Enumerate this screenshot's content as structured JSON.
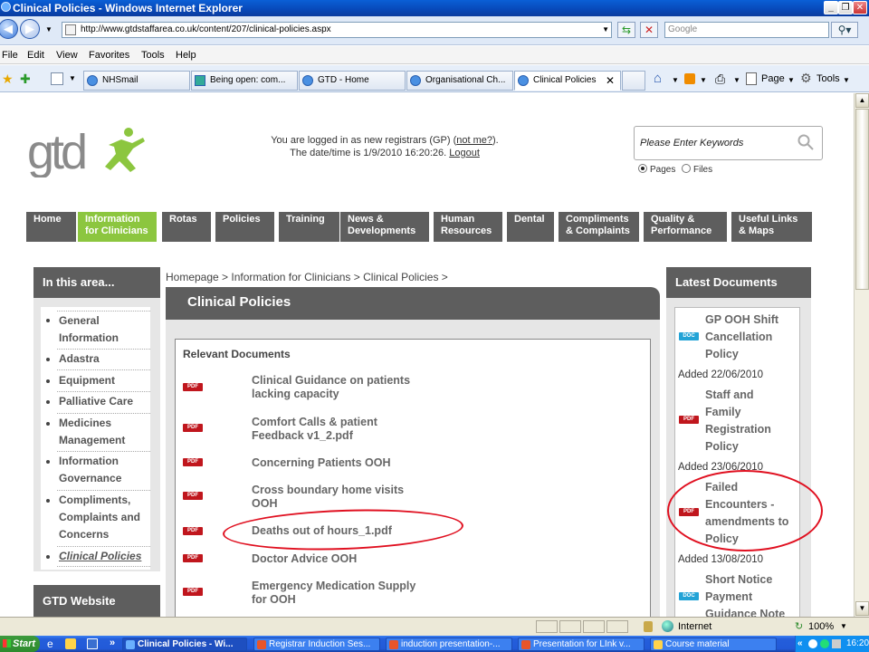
{
  "window": {
    "title": "Clinical Policies - Windows Internet Explorer"
  },
  "toolbar": {
    "address": "http://www.gtdstaffarea.co.uk/content/207/clinical-policies.aspx",
    "search_placeholder": "Google"
  },
  "menu": [
    "File",
    "Edit",
    "View",
    "Favorites",
    "Tools",
    "Help"
  ],
  "browser_tabs": [
    "NHSmail",
    "Being open: com...",
    "GTD - Home",
    "Organisational Ch...",
    "Clinical Policies"
  ],
  "toolbar_right": {
    "page": "Page",
    "tools": "Tools"
  },
  "header": {
    "login_prefix": "You are logged in as new registrars (GP) (",
    "not_me": "not me?",
    "login_suffix": ").",
    "datetime": "The date/time is 1/9/2010 16:20:26.",
    "logout": "Logout",
    "keyword_placeholder": "Please Enter Keywords",
    "radio_pages": "Pages",
    "radio_files": "Files"
  },
  "nav": [
    {
      "l1": "Home",
      "l2": ""
    },
    {
      "l1": "Information",
      "l2": "for Clinicians"
    },
    {
      "l1": "Rotas",
      "l2": ""
    },
    {
      "l1": "Policies",
      "l2": ""
    },
    {
      "l1": "Training",
      "l2": ""
    },
    {
      "l1": "News &",
      "l2": "Developments"
    },
    {
      "l1": "Human",
      "l2": "Resources"
    },
    {
      "l1": "Dental",
      "l2": ""
    },
    {
      "l1": "Compliments",
      "l2": "& Complaints"
    },
    {
      "l1": "Quality &",
      "l2": "Performance"
    },
    {
      "l1": "Useful Links",
      "l2": "& Maps"
    }
  ],
  "left": {
    "heading": "In this area...",
    "items": [
      {
        "l1": "General",
        "l2": "Information",
        "l3": ""
      },
      {
        "l1": "Adastra",
        "l2": "",
        "l3": ""
      },
      {
        "l1": "Equipment",
        "l2": "",
        "l3": ""
      },
      {
        "l1": "Palliative Care",
        "l2": "",
        "l3": ""
      },
      {
        "l1": "Medicines",
        "l2": "Management",
        "l3": ""
      },
      {
        "l1": "Information",
        "l2": "Governance",
        "l3": ""
      },
      {
        "l1": "Compliments,",
        "l2": "Complaints and",
        "l3": "Concerns"
      },
      {
        "l1": "Clinical Policies",
        "l2": "",
        "l3": ""
      }
    ],
    "website_heading": "GTD Website"
  },
  "main": {
    "breadcrumb": "Homepage > Information for Clinicians > Clinical Policies >",
    "title": "Clinical Policies",
    "relevant_heading": "Relevant Documents",
    "pdf_label": "PDF",
    "docs": [
      {
        "l1": "Clinical Guidance on patients",
        "l2": "lacking capacity"
      },
      {
        "l1": "Comfort Calls & patient",
        "l2": "Feedback v1_2.pdf"
      },
      {
        "l1": "Concerning Patients OOH",
        "l2": ""
      },
      {
        "l1": "Cross boundary home visits",
        "l2": "OOH"
      },
      {
        "l1": "Deaths out of hours_1.pdf",
        "l2": ""
      },
      {
        "l1": "Doctor Advice OOH",
        "l2": ""
      },
      {
        "l1": "Emergency Medication Supply",
        "l2": "for OOH"
      }
    ]
  },
  "right": {
    "heading": "Latest Documents",
    "doc_label": "DOC",
    "pdf_label": "PDF",
    "docs": [
      {
        "lines": [
          "GP OOH Shift",
          "Cancellation",
          "Policy"
        ],
        "added": "Added 22/06/2010"
      },
      {
        "lines": [
          "Staff and",
          "Family",
          "Registration",
          "Policy"
        ],
        "added": "Added 23/06/2010"
      },
      {
        "lines": [
          "Failed",
          "Encounters -",
          "amendments to",
          "Policy"
        ],
        "added": "Added 13/08/2010"
      },
      {
        "lines": [
          "Short Notice",
          "Payment",
          "Guidance Note"
        ],
        "added": ""
      }
    ]
  },
  "statusbar": {
    "zone": "Internet",
    "zoom": "100%"
  },
  "taskbar": {
    "start": "Start",
    "items": [
      "Clinical Policies - Wi...",
      "Registrar Induction Ses...",
      "induction presentation-...",
      "Presentation for LInk v...",
      "Course material"
    ],
    "clock": "16:20"
  },
  "colors": {
    "nav_grey": "#5e5e5e",
    "nav_active": "#8cc63f",
    "pdf_red": "#c0161d",
    "doc_blue": "#22a3d6",
    "annotation": "#e01020"
  }
}
